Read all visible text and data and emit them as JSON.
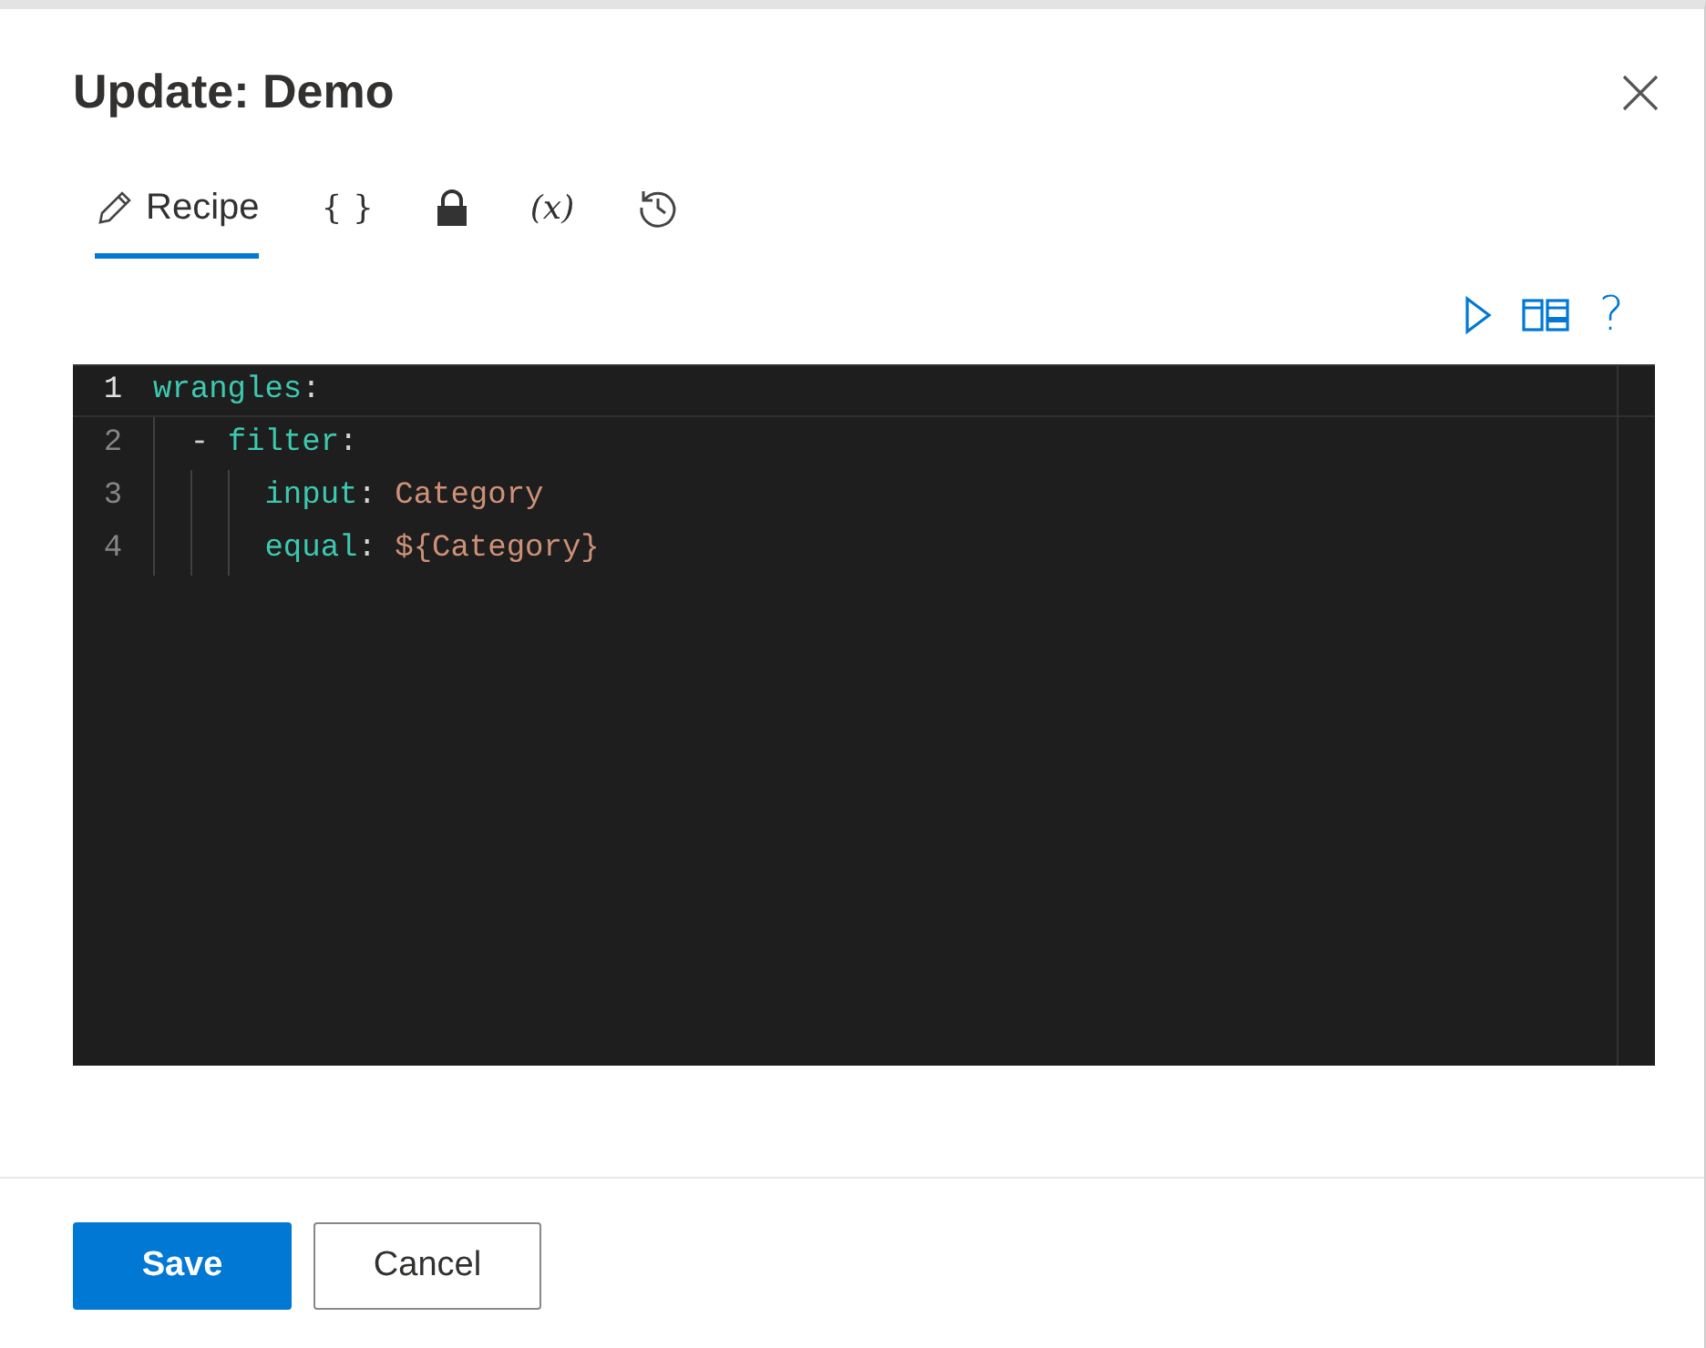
{
  "dialog": {
    "title": "Update: Demo"
  },
  "tabs": [
    {
      "kind": "pencil",
      "label": "Recipe",
      "selected": true
    },
    {
      "kind": "glyph",
      "label": "{ }",
      "selected": false
    },
    {
      "kind": "lock",
      "selected": false
    },
    {
      "kind": "glyph-italic",
      "label": "(x)",
      "selected": false
    },
    {
      "kind": "history",
      "selected": false
    }
  ],
  "toolbar": [
    {
      "kind": "run"
    },
    {
      "kind": "split"
    },
    {
      "kind": "help",
      "label": "?"
    }
  ],
  "editor": {
    "lines": [
      {
        "number": "1",
        "active": true,
        "tokens": [
          {
            "kind": "key",
            "text": "wrangles"
          },
          {
            "kind": "punct",
            "text": ":"
          }
        ]
      },
      {
        "number": "2",
        "active": false,
        "tokens": [
          {
            "kind": "punct",
            "text": "  - "
          },
          {
            "kind": "key",
            "text": "filter"
          },
          {
            "kind": "punct",
            "text": ":"
          }
        ]
      },
      {
        "number": "3",
        "active": false,
        "tokens": [
          {
            "kind": "key",
            "text": "      input"
          },
          {
            "kind": "punct",
            "text": ": "
          },
          {
            "kind": "value",
            "text": "Category"
          }
        ]
      },
      {
        "number": "4",
        "active": false,
        "tokens": [
          {
            "kind": "key",
            "text": "      equal"
          },
          {
            "kind": "punct",
            "text": ": "
          },
          {
            "kind": "value",
            "text": "${Category}"
          }
        ]
      }
    ]
  },
  "buttons": [
    {
      "label": "Save",
      "kind": "primary"
    },
    {
      "label": "Cancel",
      "kind": "secondary"
    }
  ]
}
